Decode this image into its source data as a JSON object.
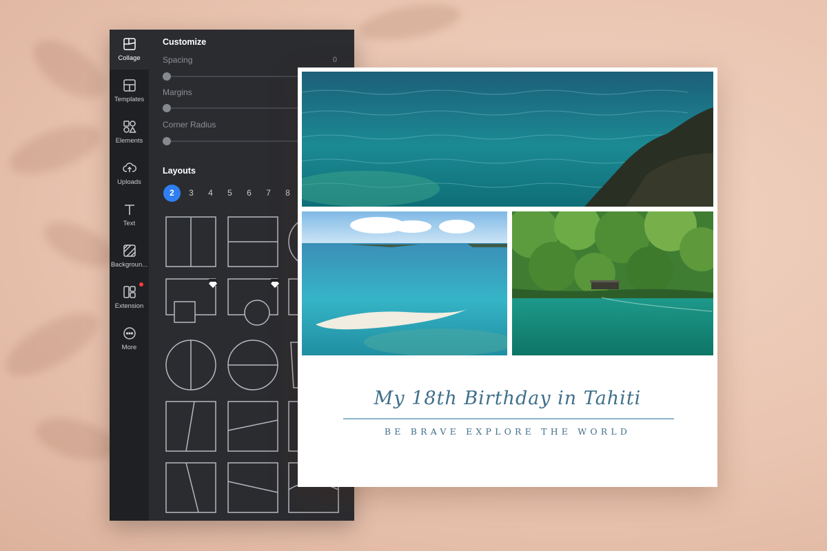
{
  "sidebar": {
    "items": [
      {
        "label": "Collage",
        "icon": "collage-icon",
        "active": true
      },
      {
        "label": "Templates",
        "icon": "templates-icon"
      },
      {
        "label": "Elements",
        "icon": "elements-icon"
      },
      {
        "label": "Uploads",
        "icon": "upload-cloud-icon"
      },
      {
        "label": "Text",
        "icon": "text-icon"
      },
      {
        "label": "Backgroun...",
        "icon": "background-icon"
      },
      {
        "label": "Extension",
        "icon": "extension-icon",
        "has_notification": true
      },
      {
        "label": "More",
        "icon": "more-icon"
      }
    ]
  },
  "customize": {
    "heading": "Customize",
    "spacing": {
      "label": "Spacing",
      "value": "0"
    },
    "margins": {
      "label": "Margins"
    },
    "corner_radius": {
      "label": "Corner Radius"
    }
  },
  "layouts": {
    "heading": "Layouts",
    "counts": [
      "2",
      "3",
      "4",
      "5",
      "6",
      "7",
      "8"
    ],
    "selected": "2"
  },
  "collage": {
    "title": "My 18th Birthday in Tahiti",
    "subtitle": "BE BRAVE EXPLORE THE WORLD"
  },
  "colors": {
    "accent": "#2f7ff2",
    "panel": "#2b2c30",
    "rail": "#1f2023",
    "title_text": "#3e6f8b"
  }
}
